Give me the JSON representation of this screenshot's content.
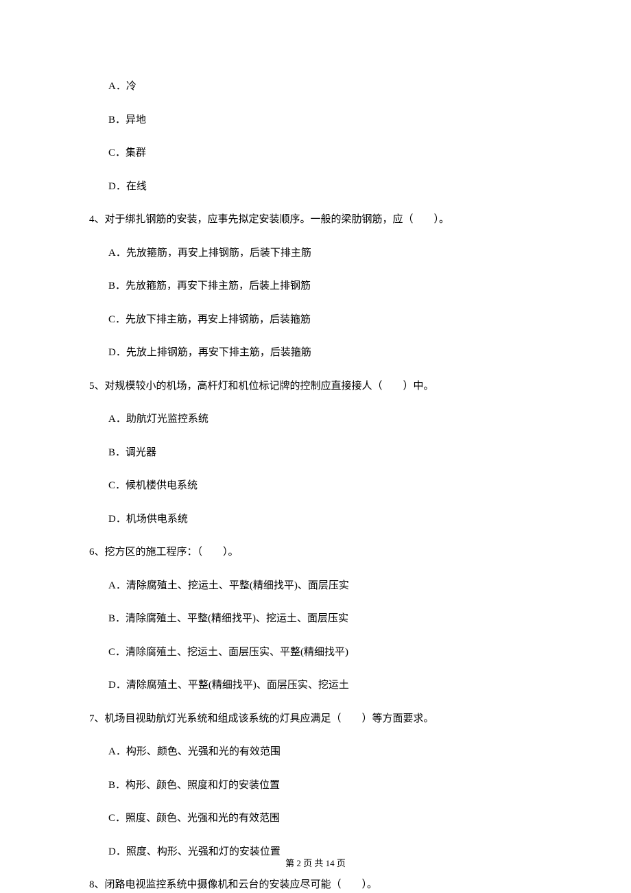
{
  "options_top": [
    {
      "label": "A．冷"
    },
    {
      "label": "B．异地"
    },
    {
      "label": "C．集群"
    },
    {
      "label": "D．在线"
    }
  ],
  "q4": {
    "text": "4、对于绑扎钢筋的安装，应事先拟定安装顺序。一般的梁肋钢筋，应（　　）。",
    "options": [
      "A．先放箍筋，再安上排钢筋，后装下排主筋",
      "B．先放箍筋，再安下排主筋，后装上排钢筋",
      "C．先放下排主筋，再安上排钢筋，后装箍筋",
      "D．先放上排钢筋，再安下排主筋，后装箍筋"
    ]
  },
  "q5": {
    "text": "5、对规模较小的机场，高杆灯和机位标记牌的控制应直接接人（　　）中。",
    "options": [
      "A．助航灯光监控系统",
      "B．调光器",
      "C．候机楼供电系统",
      "D．机场供电系统"
    ]
  },
  "q6": {
    "text": "6、挖方区的施工程序：（　　）。",
    "options": [
      "A．清除腐殖土、挖运土、平整(精细找平)、面层压实",
      "B．清除腐殖土、平整(精细找平)、挖运土、面层压实",
      "C．清除腐殖土、挖运土、面层压实、平整(精细找平)",
      "D．清除腐殖土、平整(精细找平)、面层压实、挖运土"
    ]
  },
  "q7": {
    "text": "7、机场目视助航灯光系统和组成该系统的灯具应满足（　　）等方面要求。",
    "options": [
      "A．构形、颜色、光强和光的有效范围",
      "B．构形、颜色、照度和灯的安装位置",
      "C．照度、颜色、光强和光的有效范围",
      "D．照度、构形、光强和灯的安装位置"
    ]
  },
  "q8": {
    "text": "8、闭路电视监控系统中摄像机和云台的安装应尽可能（　　）。"
  },
  "footer": "第 2 页 共 14 页"
}
